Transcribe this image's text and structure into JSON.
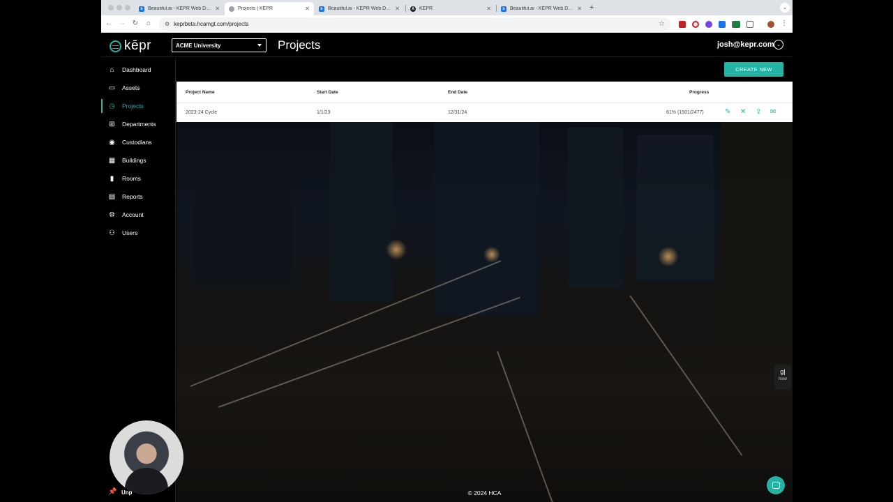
{
  "browser": {
    "tabs": [
      {
        "title": "Beautiful.ai - KEPR Web Demo",
        "favicon": "b",
        "color": "#1a73e8"
      },
      {
        "title": "Projects | KEPR",
        "favicon": "globe",
        "color": "#9aa0a6",
        "active": true
      },
      {
        "title": "Beautiful.ai - KEPR Web Demo",
        "favicon": "b",
        "color": "#1a73e8"
      },
      {
        "title": "KEPR",
        "favicon": "A",
        "color": "#202124"
      },
      {
        "title": "Beautiful.ai - KEPR Web Demo",
        "favicon": "b",
        "color": "#1a73e8"
      }
    ],
    "url": "keprbeta.hcamgt.com/projects"
  },
  "app": {
    "logo_text": "kēpr",
    "org_select": "ACME University",
    "page_title": "Projects",
    "user_email": "josh@kepr.com",
    "accent": "#25b3a3"
  },
  "sidebar": {
    "items": [
      {
        "label": "Dashboard",
        "icon": "home-icon",
        "glyph": "⌂"
      },
      {
        "label": "Assets",
        "icon": "laptop-icon",
        "glyph": "▭"
      },
      {
        "label": "Projects",
        "icon": "clock-icon",
        "glyph": "◷",
        "active": true
      },
      {
        "label": "Departments",
        "icon": "org-chart-icon",
        "glyph": "⊞"
      },
      {
        "label": "Custodians",
        "icon": "person-circle-icon",
        "glyph": "◉"
      },
      {
        "label": "Buildings",
        "icon": "building-icon",
        "glyph": "▦"
      },
      {
        "label": "Rooms",
        "icon": "door-icon",
        "glyph": "▮"
      },
      {
        "label": "Reports",
        "icon": "document-icon",
        "glyph": "▤"
      },
      {
        "label": "Account",
        "icon": "account-gear-icon",
        "glyph": "⚙"
      },
      {
        "label": "Users",
        "icon": "users-icon",
        "glyph": "👥"
      }
    ],
    "pinned_label": "Unp"
  },
  "main": {
    "create_label": "CREATE NEW",
    "table": {
      "headers": {
        "name": "Project Name",
        "start": "Start Date",
        "end": "End Date",
        "progress": "Progress"
      },
      "rows": [
        {
          "name": "2023-24 Cycle",
          "start": "1/1/23",
          "end": "12/31/24",
          "progress": "61% (1501/2477)"
        }
      ]
    },
    "footer": "© 2024 HCA",
    "widget": {
      "glyph": "g|",
      "label": "Now"
    }
  }
}
